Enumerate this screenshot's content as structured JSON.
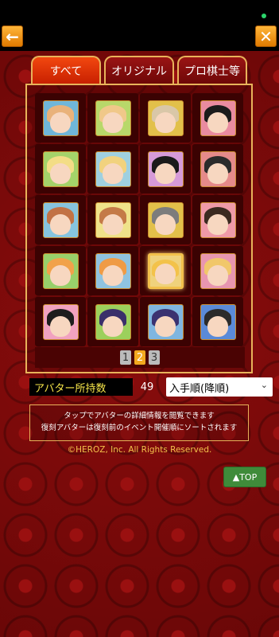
{
  "header": {
    "back_label": "←",
    "close_label": "✕"
  },
  "tabs": [
    {
      "label": "すべて",
      "active": true
    },
    {
      "label": "オリジナル",
      "active": false
    },
    {
      "label": "プロ棋士等",
      "active": false
    }
  ],
  "avatars": [
    {
      "name": "avatar-girl-pink-bg",
      "bg": "#6fb6d9",
      "hair": "#e9b27a",
      "selected": false
    },
    {
      "name": "avatar-girl-green-bg",
      "bg": "#b8d86a",
      "hair": "#f0c889",
      "selected": false
    },
    {
      "name": "avatar-man-bald-suit",
      "bg": "#e2c04a",
      "hair": "#d9c7a8",
      "selected": false
    },
    {
      "name": "avatar-girl-black-hair",
      "bg": "#e98ba0",
      "hair": "#1b1b1b",
      "selected": false
    },
    {
      "name": "avatar-girl-blonde-1",
      "bg": "#a4d36a",
      "hair": "#f3dd86",
      "selected": false
    },
    {
      "name": "avatar-girl-blonde-2",
      "bg": "#9fd0e0",
      "hair": "#f1d27e",
      "selected": false
    },
    {
      "name": "avatar-girl-purple-bg",
      "bg": "#d69ad8",
      "hair": "#1a1a1a",
      "selected": false
    },
    {
      "name": "avatar-man-glasses",
      "bg": "#e58a8a",
      "hair": "#2b2b2b",
      "selected": false
    },
    {
      "name": "avatar-girl-brown-hair-1",
      "bg": "#86c4df",
      "hair": "#c27245",
      "selected": false
    },
    {
      "name": "avatar-girl-brown-hair-2",
      "bg": "#efe28a",
      "hair": "#c47a47",
      "selected": false
    },
    {
      "name": "avatar-man-grey-suit",
      "bg": "#e2c04a",
      "hair": "#7c7c7c",
      "selected": false
    },
    {
      "name": "avatar-boy-pink-bg",
      "bg": "#ef9aa8",
      "hair": "#3b2a20",
      "selected": false
    },
    {
      "name": "avatar-girl-orange-hair-1",
      "bg": "#98d06a",
      "hair": "#f1a24a",
      "selected": false
    },
    {
      "name": "avatar-girl-orange-hair-2",
      "bg": "#8fc3e0",
      "hair": "#ef9b45",
      "selected": false
    },
    {
      "name": "avatar-girl-blonde-selected",
      "bg": "#efd27c",
      "hair": "#f3c24a",
      "selected": true
    },
    {
      "name": "avatar-girl-blonde-3",
      "bg": "#e896b0",
      "hair": "#f1c76a",
      "selected": false
    },
    {
      "name": "avatar-girl-dark-hair-badge",
      "bg": "#f1a2c0",
      "hair": "#1d1d1d",
      "selected": false
    },
    {
      "name": "avatar-girl-violet-hair-1",
      "bg": "#9cd05c",
      "hair": "#3a2f6a",
      "selected": false
    },
    {
      "name": "avatar-girl-violet-hair-2",
      "bg": "#7fb6e0",
      "hair": "#3b3270",
      "selected": false
    },
    {
      "name": "avatar-man-glasses-blue",
      "bg": "#5a8ad8",
      "hair": "#2b2b2b",
      "selected": false
    }
  ],
  "pagination": {
    "pages": [
      "1",
      "2",
      "3"
    ],
    "active": "2"
  },
  "avatar_count": {
    "label": "アバター所持数",
    "value": "49"
  },
  "sort": {
    "selected": "入手順(降順)"
  },
  "info": {
    "line1": "タップでアバターの詳細情報を閲覧できます",
    "line2": "復刻アバターは復刻前のイベント開催順にソートされます"
  },
  "copyright": "©HEROZ, Inc. All Rights Reserved.",
  "top_button": "▲TOP"
}
